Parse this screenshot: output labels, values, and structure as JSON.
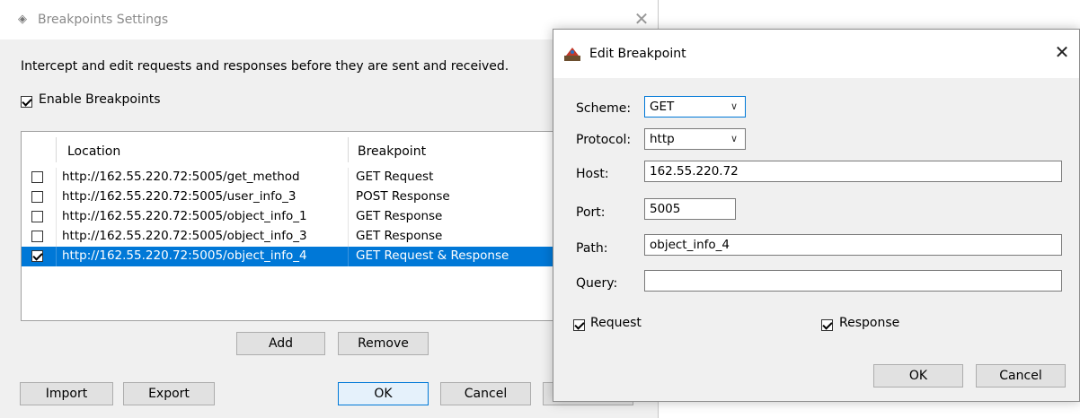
{
  "main": {
    "title": "Breakpoints Settings",
    "description": "Intercept and edit requests and responses before they are sent and received.",
    "enable_label": "Enable Breakpoints",
    "enable_checked": true,
    "table": {
      "headers": [
        "Location",
        "Breakpoint"
      ],
      "rows": [
        {
          "location": "http://162.55.220.72:5005/get_method",
          "breakpoint": "GET Request",
          "checked": false,
          "selected": false
        },
        {
          "location": "http://162.55.220.72:5005/user_info_3",
          "breakpoint": "POST Response",
          "checked": false,
          "selected": false
        },
        {
          "location": "http://162.55.220.72:5005/object_info_1",
          "breakpoint": "GET Response",
          "checked": false,
          "selected": false
        },
        {
          "location": "http://162.55.220.72:5005/object_info_3",
          "breakpoint": "GET Response",
          "checked": false,
          "selected": false
        },
        {
          "location": "http://162.55.220.72:5005/object_info_4",
          "breakpoint": "GET Request & Response",
          "checked": true,
          "selected": true
        }
      ]
    },
    "buttons": {
      "add": "Add",
      "remove": "Remove",
      "import": "Import",
      "export": "Export",
      "ok": "OK",
      "cancel": "Cancel"
    }
  },
  "dialog": {
    "title": "Edit Breakpoint",
    "labels": {
      "scheme": "Scheme:",
      "protocol": "Protocol:",
      "host": "Host:",
      "port": "Port:",
      "path": "Path:",
      "query": "Query:"
    },
    "values": {
      "scheme": "GET",
      "protocol": "http",
      "host": "162.55.220.72",
      "port": "5005",
      "path": "object_info_4",
      "query": ""
    },
    "request_label": "Request",
    "response_label": "Response",
    "request_checked": true,
    "response_checked": true,
    "buttons": {
      "ok": "OK",
      "cancel": "Cancel"
    }
  },
  "colors": {
    "selection": "#0078d7",
    "focus_border": "#0078d7"
  }
}
